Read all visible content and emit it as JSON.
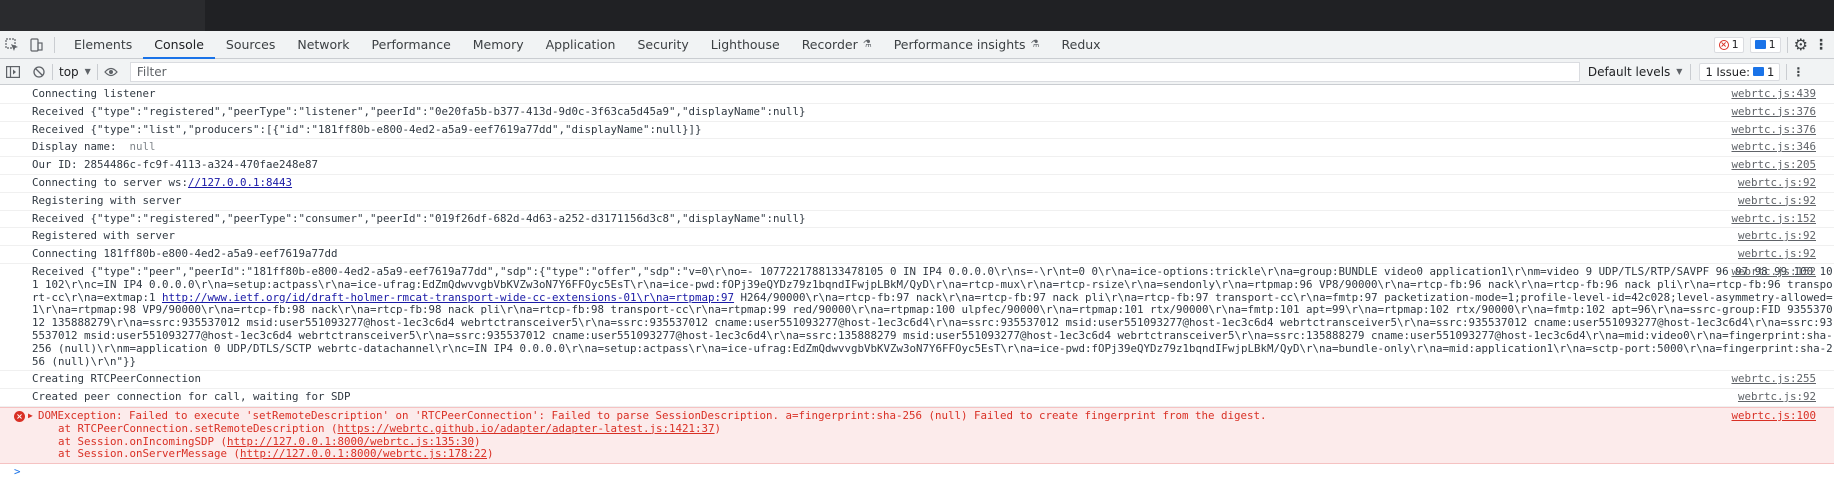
{
  "tabbar": {
    "tabs": [
      {
        "label": "Elements",
        "active": false,
        "flask": false
      },
      {
        "label": "Console",
        "active": true,
        "flask": false
      },
      {
        "label": "Sources",
        "active": false,
        "flask": false
      },
      {
        "label": "Network",
        "active": false,
        "flask": false
      },
      {
        "label": "Performance",
        "active": false,
        "flask": false
      },
      {
        "label": "Memory",
        "active": false,
        "flask": false
      },
      {
        "label": "Application",
        "active": false,
        "flask": false
      },
      {
        "label": "Security",
        "active": false,
        "flask": false
      },
      {
        "label": "Lighthouse",
        "active": false,
        "flask": false
      },
      {
        "label": "Recorder",
        "active": false,
        "flask": true
      },
      {
        "label": "Performance insights",
        "active": false,
        "flask": true
      },
      {
        "label": "Redux",
        "active": false,
        "flask": false
      }
    ],
    "error_count": "1",
    "message_count": "1"
  },
  "toolbar": {
    "context": "top",
    "filter_placeholder": "Filter",
    "levels": "Default levels",
    "issues_label": "1 Issue:",
    "issues_count": "1"
  },
  "console": {
    "rows": [
      {
        "text": "Connecting listener",
        "src": "webrtc.js:439"
      },
      {
        "text": "Received {\"type\":\"registered\",\"peerType\":\"listener\",\"peerId\":\"0e20fa5b-b377-413d-9d0c-3f63ca5d45a9\",\"displayName\":null}",
        "src": "webrtc.js:376"
      },
      {
        "text": "Received {\"type\":\"list\",\"producers\":[{\"id\":\"181ff80b-e800-4ed2-a5a9-eef7619a77dd\",\"displayName\":null}]}",
        "src": "webrtc.js:376"
      },
      {
        "text": "Display name:",
        "null": "null",
        "src": "webrtc.js:346"
      },
      {
        "text": "Our ID: 2854486c-fc9f-4113-a324-470fae248e87",
        "src": "webrtc.js:205"
      },
      {
        "text": "Connecting to server ws:",
        "link": "//127.0.0.1:8443",
        "src": "webrtc.js:92"
      },
      {
        "text": "Registering with server",
        "src": "webrtc.js:92"
      },
      {
        "text": "Received {\"type\":\"registered\",\"peerType\":\"consumer\",\"peerId\":\"019f26df-682d-4d63-a252-d3171156d3c8\",\"displayName\":null}",
        "src": "webrtc.js:152"
      },
      {
        "text": "Registered with server",
        "src": "webrtc.js:92"
      },
      {
        "text": "Connecting 181ff80b-e800-4ed2-a5a9-eef7619a77dd",
        "src": "webrtc.js:92"
      }
    ],
    "long_row": {
      "part1": "Received {\"type\":\"peer\",\"peerId\":\"181ff80b-e800-4ed2-a5a9-eef7619a77dd\",\"sdp\":{\"type\":\"offer\",\"sdp\":\"v=0\\r\\no=- 1077221788133478105 0 IN IP4 0.0.0.0\\r\\ns=-\\r\\nt=0 0\\r\\na=ice-options:trickle\\r\\na=group:BUNDLE video0 application1\\r\\nm=video 9 UDP/TLS/RTP/SAVPF 96 97 98 99 100 101 102\\r\\nc=IN IP4 0.0.0.0\\r\\na=setup:actpass\\r\\na=ice-ufrag:EdZmQdwvvgbVbKVZw3oN7Y6FFOyc5EsT\\r\\na=ice-pwd:fOPj39eQYDz79z1bqndIFwjpLBkM/QyD\\r\\na=rtcp-mux\\r\\na=rtcp-rsize\\r\\na=sendonly\\r\\na=rtpmap:96 VP8/90000\\r\\na=rtcp-fb:96 nack\\r\\na=rtcp-fb:96 nack pli\\r\\na=rtcp-fb:96 transport-cc\\r\\na=extmap:1 ",
      "link": "http://www.ietf.org/id/draft-holmer-rmcat-transport-wide-cc-extensions-01\\r\\na=rtpmap:97",
      "part2": " H264/90000\\r\\na=rtcp-fb:97 nack\\r\\na=rtcp-fb:97 nack pli\\r\\na=rtcp-fb:97 transport-cc\\r\\na=fmtp:97 packetization-mode=1;profile-level-id=42c028;level-asymmetry-allowed=1\\r\\na=rtpmap:98 VP9/90000\\r\\na=rtcp-fb:98 nack\\r\\na=rtcp-fb:98 nack pli\\r\\na=rtcp-fb:98 transport-cc\\r\\na=rtpmap:99 red/90000\\r\\na=rtpmap:100 ulpfec/90000\\r\\na=rtpmap:101 rtx/90000\\r\\na=fmtp:101 apt=99\\r\\na=rtpmap:102 rtx/90000\\r\\na=fmtp:102 apt=96\\r\\na=ssrc-group:FID 935537012 135888279\\r\\na=ssrc:935537012 msid:user551093277@host-1ec3c6d4 webrtctransceiver5\\r\\na=ssrc:935537012 cname:user551093277@host-1ec3c6d4\\r\\na=ssrc:935537012 msid:user551093277@host-1ec3c6d4 webrtctransceiver5\\r\\na=ssrc:935537012 cname:user551093277@host-1ec3c6d4\\r\\na=ssrc:935537012 msid:user551093277@host-1ec3c6d4 webrtctransceiver5\\r\\na=ssrc:935537012 cname:user551093277@host-1ec3c6d4\\r\\na=ssrc:135888279 msid:user551093277@host-1ec3c6d4 webrtctransceiver5\\r\\na=ssrc:135888279 cname:user551093277@host-1ec3c6d4\\r\\na=mid:video0\\r\\na=fingerprint:sha-256 (null)\\r\\nm=application 0 UDP/DTLS/SCTP webrtc-datachannel\\r\\nc=IN IP4 0.0.0.0\\r\\na=setup:actpass\\r\\na=ice-ufrag:EdZmQdwvvgbVbKVZw3oN7Y6FFOyc5EsT\\r\\na=ice-pwd:fOPj39eQYDz79z1bqndIFwjpLBkM/QyD\\r\\na=bundle-only\\r\\na=mid:application1\\r\\na=sctp-port:5000\\r\\na=fingerprint:sha-256 (null)\\r\\n\"}}",
      "src": "webrtc.js:152"
    },
    "rows2": [
      {
        "text": "Creating RTCPeerConnection",
        "src": "webrtc.js:255"
      },
      {
        "text": "Created peer connection for call, waiting for SDP",
        "src": "webrtc.js:92"
      }
    ],
    "error": {
      "message": "DOMException: Failed to execute 'setRemoteDescription' on 'RTCPeerConnection': Failed to parse SessionDescription. a=fingerprint:sha-256 (null) Failed to create fingerprint from the digest.",
      "src": "webrtc.js:100",
      "stack": [
        {
          "prefix": "at RTCPeerConnection.setRemoteDescription (",
          "link": "https://webrtc.github.io/adapter/adapter-latest.js:1421:37",
          "suffix": ")"
        },
        {
          "prefix": "at Session.onIncomingSDP (",
          "link": "http://127.0.0.1:8000/webrtc.js:135:30",
          "suffix": ")"
        },
        {
          "prefix": "at Session.onServerMessage (",
          "link": "http://127.0.0.1:8000/webrtc.js:178:22",
          "suffix": ")"
        }
      ]
    },
    "prompt": ">"
  }
}
